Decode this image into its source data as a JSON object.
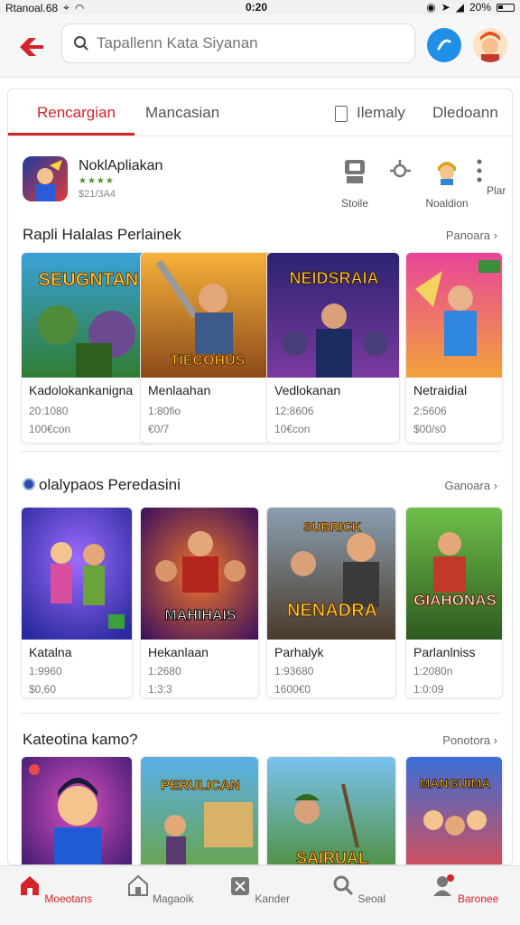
{
  "status_bar": {
    "carrier": "Rtanoal.68",
    "time": "0:20",
    "battery": "20%"
  },
  "search": {
    "placeholder": "Tapallenn Kata Siyanan"
  },
  "tabs": [
    {
      "label": "Rencargian",
      "active": true
    },
    {
      "label": "Mancasian",
      "active": false
    },
    {
      "label": "Ilemaly",
      "active": false
    },
    {
      "label": "Dledoann",
      "active": false
    }
  ],
  "app": {
    "title": "NoklApliakan",
    "stars": "★★★★",
    "meta": "$21/3A4"
  },
  "quick_actions": [
    {
      "label": "Stoile",
      "icon": "store-icon"
    },
    {
      "label": "",
      "icon": "share-icon"
    },
    {
      "label": "Noaldion",
      "icon": "character-icon"
    },
    {
      "label": "Plar",
      "icon": "more-icon"
    }
  ],
  "sections": [
    {
      "title": "Rapli Halalas Perlainek",
      "link": "Panoara",
      "items": [
        {
          "art_title": "SEUGNTAN",
          "name": "Kadolokankanigna",
          "m1": "20:1080",
          "m2": "100€con"
        },
        {
          "art_title": "TIECOHUS",
          "name": "Menlaahan",
          "m1": "1:80fio",
          "m2": "€0/7"
        },
        {
          "art_title": "NEIDSRAIA",
          "name": "Vedlokanan",
          "m1": "12:8606",
          "m2": "10€con"
        },
        {
          "art_title": "",
          "name": "Netraidial",
          "m1": "2:5606",
          "m2": "$00/s0"
        }
      ]
    },
    {
      "title": "olalypaos Peredasini",
      "link": "Ganoara",
      "items": [
        {
          "art_title": "",
          "name": "Katalna",
          "m1": "1:9960",
          "m2": "$0,60"
        },
        {
          "art_title": "MAHIHAIS",
          "name": "Hekanlaan",
          "m1": "1:2680",
          "m2": "1:3:3"
        },
        {
          "art_title": "NENADRA",
          "name": "Parhalyk",
          "m1": "1:93680",
          "m2": "1600€0"
        },
        {
          "art_title": "GIAHONAS",
          "name": "Parlanlniss",
          "m1": "1:2080n",
          "m2": "1:0:09"
        }
      ]
    },
    {
      "title": "Kateotina kamo?",
      "link": "Ponotora",
      "items": [
        {
          "art_title": "",
          "name": "",
          "m1": "",
          "m2": ""
        },
        {
          "art_title": "PERULICAN",
          "name": "",
          "m1": "",
          "m2": ""
        },
        {
          "art_title": "SAIRUAL",
          "name": "",
          "m1": "",
          "m2": ""
        },
        {
          "art_title": "MANGUIMA",
          "name": "",
          "m1": "",
          "m2": ""
        }
      ]
    }
  ],
  "bottom_nav": [
    {
      "label": "Moeotans",
      "icon": "home-icon",
      "active": true
    },
    {
      "label": "Magaoik",
      "icon": "house-icon",
      "active": false
    },
    {
      "label": "Kander",
      "icon": "calendar-icon",
      "active": false
    },
    {
      "label": "Seoal",
      "icon": "search-icon",
      "active": false
    },
    {
      "label": "Baronee",
      "icon": "profile-icon",
      "active": true
    }
  ],
  "colors": {
    "accent": "#d6232a",
    "blue": "#1f8fe8",
    "star": "#5a8f2b"
  }
}
